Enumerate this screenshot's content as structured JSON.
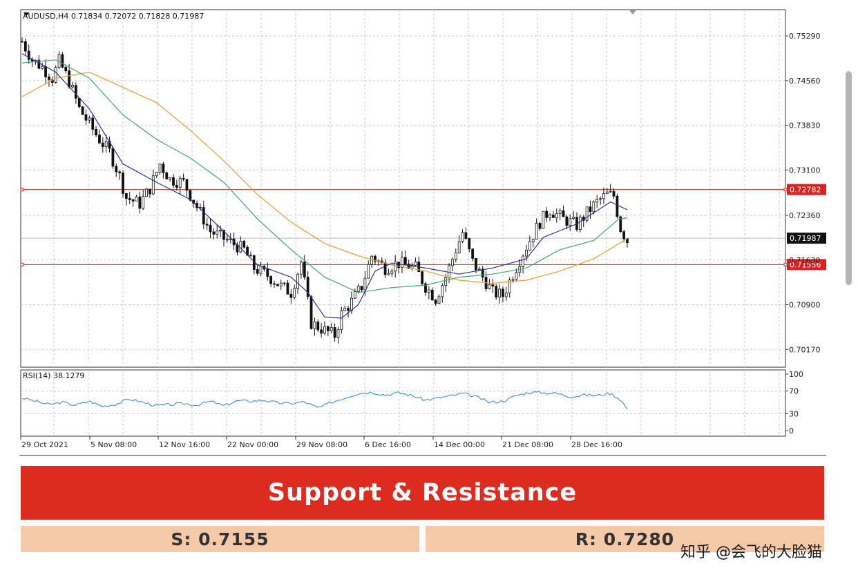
{
  "chart_data": [
    {
      "type": "candlestick",
      "symbol_header": "AUDUSD,H4  0.71834 0.72072 0.71828 0.71987",
      "y_ticks": [
        "0.75290",
        "0.74560",
        "0.73830",
        "0.73100",
        "0.72360",
        "0.71630",
        "0.70900",
        "0.70170"
      ],
      "ylim": [
        0.6988,
        0.7572
      ],
      "x_ticks": [
        "29 Oct 2021",
        "5 Nov 08:00",
        "12 Nov 16:00",
        "22 Nov 00:00",
        "29 Nov 08:00",
        "6 Dec 16:00",
        "14 Dec 00:00",
        "21 Dec 08:00",
        "28 Dec 16:00"
      ],
      "current_price": "0.71987",
      "levels": [
        {
          "value": 0.72782,
          "label": "0.72782",
          "color": "#e02020"
        },
        {
          "value": 0.71556,
          "label": "0.71556",
          "color": "#e02020"
        }
      ],
      "close_path": [
        [
          0,
          0.752
        ],
        [
          6,
          0.749
        ],
        [
          12,
          0.7478
        ],
        [
          18,
          0.746
        ],
        [
          22,
          0.7488
        ],
        [
          28,
          0.7455
        ],
        [
          34,
          0.741
        ],
        [
          40,
          0.7385
        ],
        [
          46,
          0.736
        ],
        [
          52,
          0.734
        ],
        [
          58,
          0.73
        ],
        [
          62,
          0.7265
        ],
        [
          70,
          0.7255
        ],
        [
          76,
          0.728
        ],
        [
          82,
          0.732
        ],
        [
          88,
          0.7295
        ],
        [
          96,
          0.729
        ],
        [
          104,
          0.725
        ],
        [
          112,
          0.721
        ],
        [
          122,
          0.7195
        ],
        [
          132,
          0.718
        ],
        [
          138,
          0.715
        ],
        [
          146,
          0.7138
        ],
        [
          154,
          0.712
        ],
        [
          160,
          0.711
        ],
        [
          166,
          0.716
        ],
        [
          172,
          0.706
        ],
        [
          180,
          0.7048
        ],
        [
          186,
          0.704
        ],
        [
          190,
          0.7075
        ],
        [
          196,
          0.7095
        ],
        [
          202,
          0.712
        ],
        [
          208,
          0.717
        ],
        [
          216,
          0.715
        ],
        [
          224,
          0.7158
        ],
        [
          234,
          0.715
        ],
        [
          240,
          0.712
        ],
        [
          246,
          0.71
        ],
        [
          252,
          0.7135
        ],
        [
          258,
          0.718
        ],
        [
          262,
          0.7208
        ],
        [
          268,
          0.716
        ],
        [
          274,
          0.7135
        ],
        [
          280,
          0.711
        ],
        [
          286,
          0.7105
        ],
        [
          292,
          0.714
        ],
        [
          298,
          0.7175
        ],
        [
          302,
          0.7195
        ],
        [
          308,
          0.7225
        ],
        [
          314,
          0.7245
        ],
        [
          322,
          0.723
        ],
        [
          330,
          0.722
        ],
        [
          336,
          0.724
        ],
        [
          342,
          0.7258
        ],
        [
          348,
          0.727
        ],
        [
          352,
          0.7268
        ],
        [
          356,
          0.7215
        ],
        [
          360,
          0.7195
        ]
      ],
      "ma_fast": [
        [
          0,
          0.75
        ],
        [
          20,
          0.747
        ],
        [
          40,
          0.741
        ],
        [
          60,
          0.732
        ],
        [
          80,
          0.729
        ],
        [
          100,
          0.7262
        ],
        [
          120,
          0.721
        ],
        [
          140,
          0.7155
        ],
        [
          160,
          0.7135
        ],
        [
          170,
          0.711
        ],
        [
          180,
          0.707
        ],
        [
          190,
          0.7068
        ],
        [
          200,
          0.709
        ],
        [
          210,
          0.7145
        ],
        [
          220,
          0.7158
        ],
        [
          240,
          0.715
        ],
        [
          260,
          0.714
        ],
        [
          280,
          0.715
        ],
        [
          300,
          0.7165
        ],
        [
          310,
          0.72
        ],
        [
          330,
          0.7222
        ],
        [
          350,
          0.7258
        ],
        [
          360,
          0.7245
        ]
      ],
      "ma_mid": [
        [
          0,
          0.7485
        ],
        [
          20,
          0.749
        ],
        [
          40,
          0.746
        ],
        [
          60,
          0.74
        ],
        [
          80,
          0.736
        ],
        [
          100,
          0.733
        ],
        [
          120,
          0.729
        ],
        [
          140,
          0.723
        ],
        [
          160,
          0.718
        ],
        [
          180,
          0.7135
        ],
        [
          200,
          0.711
        ],
        [
          220,
          0.7118
        ],
        [
          240,
          0.7122
        ],
        [
          260,
          0.7135
        ],
        [
          280,
          0.714
        ],
        [
          300,
          0.715
        ],
        [
          320,
          0.718
        ],
        [
          340,
          0.7195
        ],
        [
          355,
          0.723
        ],
        [
          360,
          0.7232
        ]
      ],
      "ma_slow": [
        [
          0,
          0.743
        ],
        [
          20,
          0.746
        ],
        [
          40,
          0.747
        ],
        [
          60,
          0.7445
        ],
        [
          80,
          0.742
        ],
        [
          100,
          0.7375
        ],
        [
          120,
          0.7325
        ],
        [
          140,
          0.727
        ],
        [
          160,
          0.7225
        ],
        [
          180,
          0.719
        ],
        [
          200,
          0.717
        ],
        [
          220,
          0.7155
        ],
        [
          240,
          0.7145
        ],
        [
          260,
          0.713
        ],
        [
          280,
          0.7125
        ],
        [
          300,
          0.713
        ],
        [
          320,
          0.7145
        ],
        [
          340,
          0.7165
        ],
        [
          360,
          0.7198
        ]
      ]
    },
    {
      "type": "line",
      "indicator_label": "RSI(14) 38.1279",
      "y_ticks": [
        "100",
        "70",
        "30",
        "0"
      ],
      "ylim": [
        0,
        100
      ],
      "levels": [
        70,
        30
      ],
      "values": [
        [
          0,
          58
        ],
        [
          8,
          52
        ],
        [
          16,
          46
        ],
        [
          24,
          50
        ],
        [
          32,
          45
        ],
        [
          40,
          52
        ],
        [
          48,
          43
        ],
        [
          56,
          47
        ],
        [
          64,
          56
        ],
        [
          72,
          50
        ],
        [
          80,
          44
        ],
        [
          88,
          46
        ],
        [
          96,
          48
        ],
        [
          104,
          45
        ],
        [
          112,
          52
        ],
        [
          120,
          44
        ],
        [
          128,
          53
        ],
        [
          136,
          52
        ],
        [
          144,
          54
        ],
        [
          152,
          49
        ],
        [
          160,
          48
        ],
        [
          168,
          51
        ],
        [
          176,
          40
        ],
        [
          184,
          50
        ],
        [
          192,
          58
        ],
        [
          200,
          66
        ],
        [
          208,
          68
        ],
        [
          216,
          63
        ],
        [
          224,
          67
        ],
        [
          232,
          62
        ],
        [
          240,
          54
        ],
        [
          248,
          58
        ],
        [
          256,
          62
        ],
        [
          262,
          66
        ],
        [
          270,
          60
        ],
        [
          278,
          50
        ],
        [
          286,
          52
        ],
        [
          294,
          62
        ],
        [
          302,
          68
        ],
        [
          310,
          67
        ],
        [
          318,
          66
        ],
        [
          326,
          60
        ],
        [
          334,
          63
        ],
        [
          342,
          62
        ],
        [
          350,
          66
        ],
        [
          356,
          55
        ],
        [
          360,
          38
        ]
      ]
    }
  ],
  "banner": {
    "title": "Support & Resistance"
  },
  "support": {
    "label": "S: 0.7155"
  },
  "resistance": {
    "label": "R: 0.7280"
  },
  "watermark": {
    "text": "知乎 @会飞的大脸猫"
  },
  "colors": {
    "level_line": "#e02020",
    "ma_fast": "#2b2f9e",
    "ma_mid": "#3aa874",
    "ma_slow": "#f39a2a",
    "rsi_line": "#3c8ee0",
    "banner_bg": "#dd2b1f",
    "sr_box_bg": "#f5c8a8",
    "current_price_tag": "#111111"
  }
}
